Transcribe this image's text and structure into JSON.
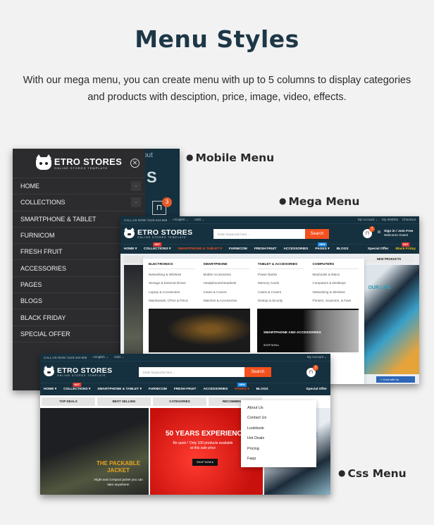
{
  "title": "Menu Styles",
  "description": "With our mega menu, you can create menu with up to 5 columns to display categories and products with desciption, price, image, video, effects.",
  "labels": {
    "mobile": "Mobile Menu",
    "mega": "Mega Menu",
    "css": "Css Menu"
  },
  "colors": {
    "brand_dark": "#15303e",
    "accent": "#f4511e",
    "heading": "#1d3747"
  },
  "logo": {
    "name": "ETRO STORES",
    "tagline": "ONLINE STORES TEMPLATE"
  },
  "mobile_menu": {
    "bg_text_about": "out",
    "bg_text_s": "S",
    "cart_count": "3",
    "items": [
      {
        "label": "HOME",
        "has_chevron": true
      },
      {
        "label": "COLLECTIONS",
        "has_chevron": true
      },
      {
        "label": "SMARTPHONE & TABLET"
      },
      {
        "label": "FURNICOM"
      },
      {
        "label": "FRESH FRUIT"
      },
      {
        "label": "ACCESSORIES"
      },
      {
        "label": "PAGES"
      },
      {
        "label": "BLOGS"
      },
      {
        "label": "BLACK FRIDAY"
      },
      {
        "label": "SPECIAL OFFER"
      }
    ]
  },
  "store": {
    "call": "CALL US NOW: 0123-444-666",
    "language": "English",
    "currency": "USD",
    "my_account": "My Account",
    "wishlist": "My Wishlist",
    "checkout": "Checkout",
    "search_placeholder": "Enter keywords here...",
    "search_button": "Search",
    "cart_count": "3",
    "signin": "Sign in / Join Free",
    "welcome": "Welcome Guest",
    "nav": {
      "home": "HOME",
      "collections": "COLLECTIONS",
      "smartphone": "SMARTPHONE & TABLET",
      "furnicom": "FURNICOM",
      "fresh_fruit": "FRESH FRUIT",
      "accessories": "ACCESSORIES",
      "pages": "PAGES",
      "blogs": "BLOGS",
      "special_offer": "Special Offer",
      "black_friday": "Black Friday",
      "hot_tag": "HOT",
      "new_tag": "NEW"
    }
  },
  "mega_menu": {
    "new_products_tab": "NEW PRODUCTS",
    "our_life": "OUR LIFE",
    "chat": "Chat with Us",
    "columns": [
      {
        "heading": "ELECTRONICS",
        "items": [
          "Networking & Wireless",
          "Storage & External Drives",
          "Laptop & Accessories",
          "Mainboards, CPUs & PSUs"
        ]
      },
      {
        "heading": "SMARTPHONE",
        "items": [
          "Mobile Accessories",
          "Headphones/Headsets",
          "Cases & Covers",
          "Watches & Accessories"
        ]
      },
      {
        "heading": "TABLET & ACCESORIES",
        "items": [
          "Power Banks",
          "Memory Cards",
          "Cases & Covers",
          "Destop & Sicurity"
        ]
      },
      {
        "heading": "COMPUTERS",
        "items": [
          "Macbooks & iMacs",
          "Computers & Desktops",
          "Networking & Wireless",
          "Printers, Scanners, & Faxs"
        ]
      }
    ],
    "banner2_title": "SMARTPHONE AND ACCESSORIES",
    "banner2_cta": "SHOP NOW"
  },
  "css_menu": {
    "tabs": [
      "TOP DEALS",
      "BEST SELLING",
      "CATEGORIES",
      "RECOMMENDED"
    ],
    "banner1_title": "THE PACKABLE JACKET",
    "banner1_sub": "Alight and compact jacket you can take anywhere!",
    "banner2_title": "50 YEARS EXPERIENCE",
    "banner2_sub": "Be quick ! Only 100 products available at this sale price",
    "banner2_cta": "SHOP NOW",
    "banner3_title": "UR LIFE",
    "dropdown": [
      "About Us",
      "Contact Us",
      "Lookbook",
      "Hot Deals",
      "Pricing",
      "Faqs"
    ]
  }
}
